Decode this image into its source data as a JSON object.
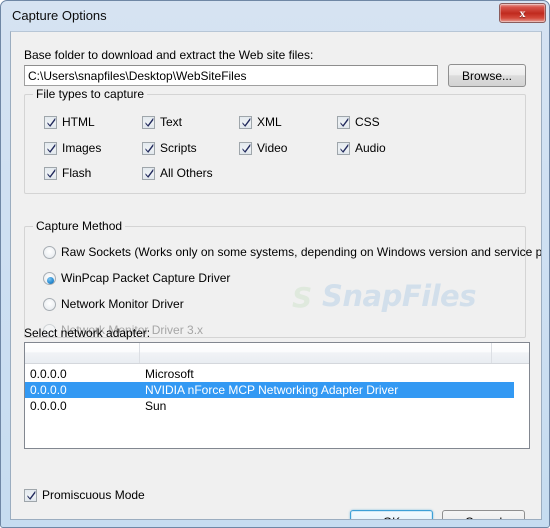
{
  "window": {
    "title": "Capture Options",
    "close_label": "x"
  },
  "watermark": {
    "logo": "S",
    "text": "SnapFiles"
  },
  "base_folder": {
    "label": "Base folder to download and extract the Web site files:",
    "value": "C:\\Users\\snapfiles\\Desktop\\WebSiteFiles",
    "placeholder": "",
    "browse_label": "Browse..."
  },
  "file_types": {
    "title": "File types to capture",
    "items": [
      {
        "label": "HTML",
        "checked": true
      },
      {
        "label": "Text",
        "checked": true
      },
      {
        "label": "XML",
        "checked": true
      },
      {
        "label": "CSS",
        "checked": true
      },
      {
        "label": "Images",
        "checked": true
      },
      {
        "label": "Scripts",
        "checked": true
      },
      {
        "label": "Video",
        "checked": true
      },
      {
        "label": "Audio",
        "checked": true
      },
      {
        "label": "Flash",
        "checked": true
      },
      {
        "label": "All Others",
        "checked": true
      }
    ]
  },
  "capture_method": {
    "title": "Capture Method",
    "options": [
      {
        "label": "Raw Sockets  (Works only on some systems, depending on Windows version and service pack)",
        "selected": false,
        "disabled": false
      },
      {
        "label": "WinPcap Packet Capture Driver",
        "selected": true,
        "disabled": false
      },
      {
        "label": "Network Monitor Driver",
        "selected": false,
        "disabled": false
      },
      {
        "label": "Network Monitor Driver 3.x",
        "selected": false,
        "disabled": true
      }
    ]
  },
  "network_adapter": {
    "label": "Select network adapter:",
    "columns": [
      "",
      "",
      ""
    ],
    "rows": [
      {
        "ip": "0.0.0.0",
        "name": "Microsoft",
        "selected": false
      },
      {
        "ip": "0.0.0.0",
        "name": "NVIDIA nForce MCP Networking Adapter Driver",
        "selected": true
      },
      {
        "ip": "0.0.0.0",
        "name": "Sun",
        "selected": false
      }
    ]
  },
  "promiscuous": {
    "label": "Promiscuous Mode",
    "checked": true
  },
  "buttons": {
    "ok": "OK",
    "cancel": "Cancel"
  },
  "colors": {
    "selection": "#3399f3",
    "close_button": "#c02a1e",
    "focus_border": "#3c9fd6",
    "watermark": "#d2dfeb"
  }
}
